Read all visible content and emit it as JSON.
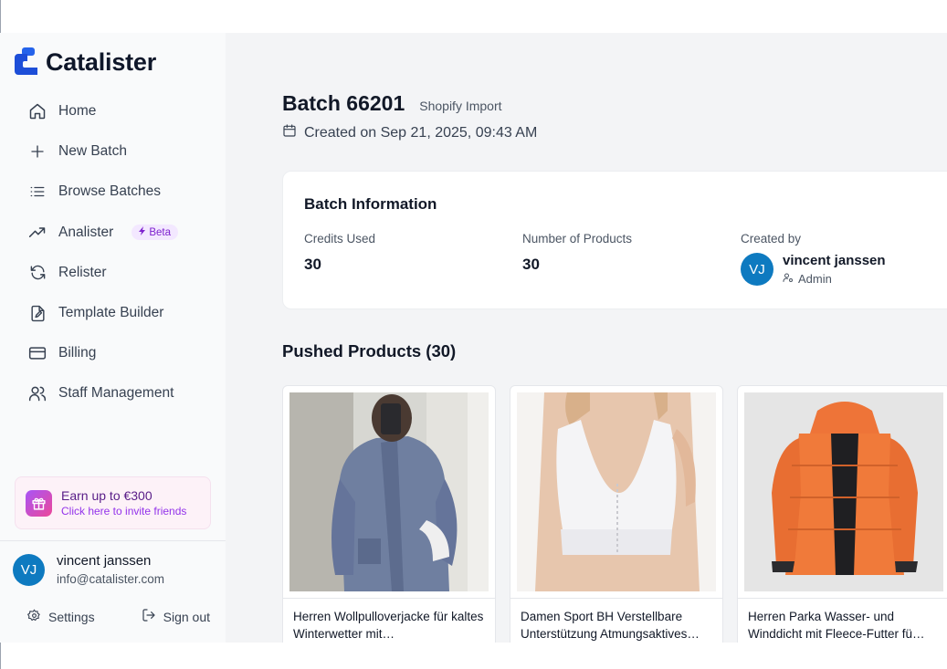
{
  "brand": {
    "name": "Catalister"
  },
  "nav": {
    "items": [
      {
        "label": "Home",
        "icon": "home-icon"
      },
      {
        "label": "New Batch",
        "icon": "plus-icon"
      },
      {
        "label": "Browse Batches",
        "icon": "list-icon"
      },
      {
        "label": "Analister",
        "icon": "trending-icon",
        "badge": "Beta"
      },
      {
        "label": "Relister",
        "icon": "refresh-icon"
      },
      {
        "label": "Template Builder",
        "icon": "file-edit-icon"
      },
      {
        "label": "Billing",
        "icon": "credit-card-icon"
      },
      {
        "label": "Staff Management",
        "icon": "users-icon"
      }
    ]
  },
  "promo": {
    "title": "Earn up to €300",
    "subtitle": "Click here to invite friends"
  },
  "user": {
    "initials": "VJ",
    "name": "vincent janssen",
    "email": "info@catalister.com"
  },
  "footer": {
    "settings_label": "Settings",
    "signout_label": "Sign out"
  },
  "batch": {
    "title": "Batch 66201",
    "source": "Shopify Import",
    "created": "Created on Sep 21, 2025, 09:43 AM"
  },
  "info": {
    "title": "Batch Information",
    "credits_label": "Credits Used",
    "credits_value": "30",
    "products_label": "Number of Products",
    "products_value": "30",
    "created_by_label": "Created by",
    "creator_initials": "VJ",
    "creator_name": "vincent janssen",
    "creator_role": "Admin"
  },
  "pushed": {
    "title": "Pushed Products (30)",
    "products": [
      {
        "name": "Herren Wollpulloverjacke für kaltes Winterwetter mit…"
      },
      {
        "name": "Damen Sport BH Verstellbare Unterstützung Atmungsaktives…"
      },
      {
        "name": "Herren Parka Wasser- und Winddicht mit Fleece-Futter fü…"
      }
    ]
  },
  "colors": {
    "accent": "#0e7ac0",
    "brand_blue": "#1d6cf2",
    "beta_purple": "#7e22ce",
    "jacket_orange": "#f07a3a"
  }
}
